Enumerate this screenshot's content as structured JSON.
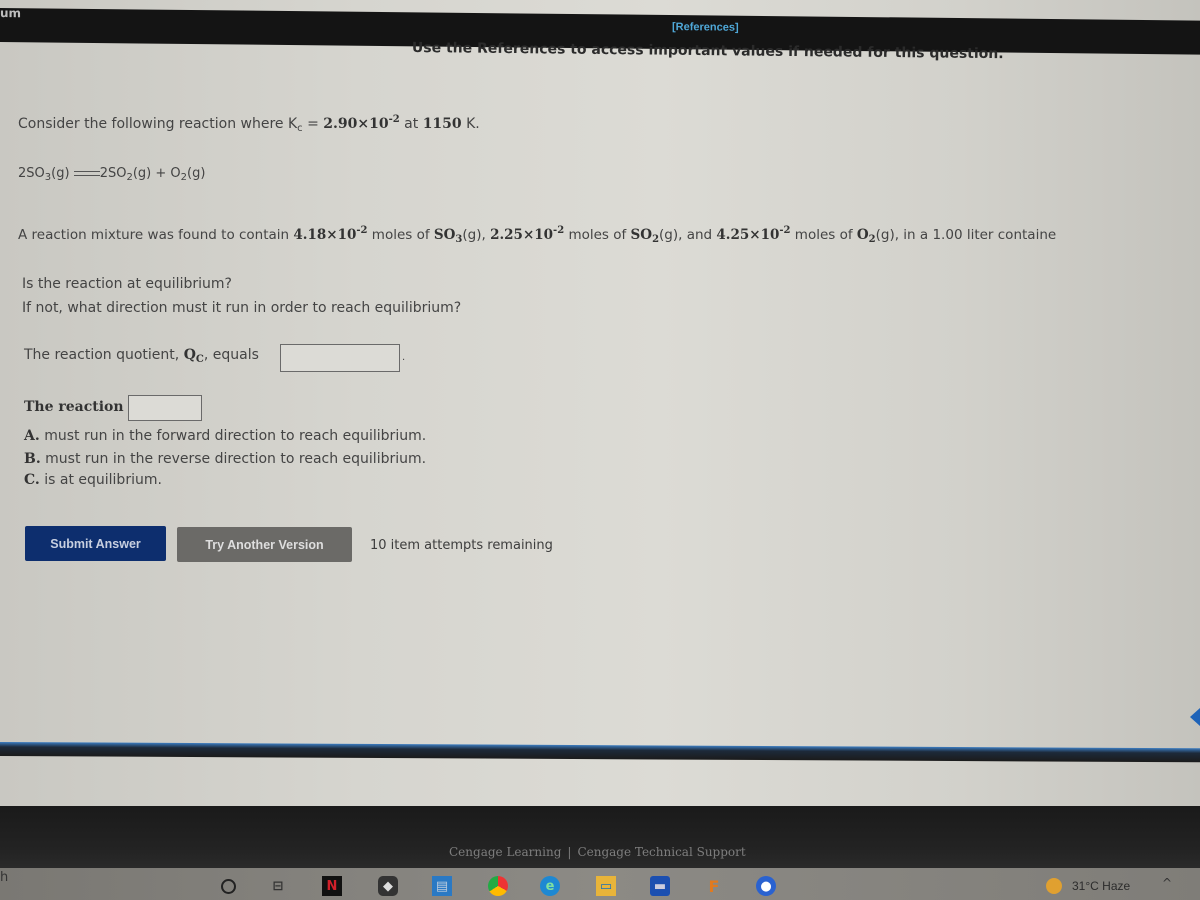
{
  "header": {
    "left_label": "um",
    "references_link": "[References]",
    "note": "Use the References to access important values if needed for this question."
  },
  "question": {
    "intro_prefix": "Consider the following reaction where K",
    "intro_kc_sub": "c",
    "intro_eq": " = ",
    "kc_value_mantissa": "2.90×10",
    "kc_value_exp": "-2",
    "intro_at": " at ",
    "temperature": "1150",
    "temperature_unit": " K.",
    "reaction": {
      "reactant_coef": "2SO",
      "reactant_sub": "3",
      "reactant_state": "(g)",
      "product1_coef": "2SO",
      "product1_sub": "2",
      "product1_state": "(g)",
      "plus": " + ",
      "product2": "O",
      "product2_sub": "2",
      "product2_state": "(g)"
    },
    "mixture": {
      "prefix": "A reaction mixture was found to contain ",
      "so3_amount": "4.18×10",
      "so3_exp": "-2",
      "moles_of": " moles of ",
      "so3_label": "SO",
      "so3_sub": "3",
      "so3_state": "(g), ",
      "so2_amount": "2.25×10",
      "so2_exp": "-2",
      "so2_label": "SO",
      "so2_sub": "2",
      "so2_state": "(g), and ",
      "o2_amount": "4.25×10",
      "o2_exp": "-2",
      "o2_label": "O",
      "o2_sub": "2",
      "o2_state": "(g), in a 1.00 liter containe"
    },
    "q1": "Is the reaction at equilibrium?",
    "q2": "If not, what direction must it run in order to reach equilibrium?",
    "qc_prefix": "The reaction quotient, ",
    "qc_symbol": "Q",
    "qc_sub": "C",
    "qc_suffix": ", equals",
    "qc_value": "",
    "qc_period": ".",
    "reaction_label": "The reaction",
    "reaction_value": "",
    "options": [
      {
        "letter": "A.",
        "text": " must run in the forward direction to reach equilibrium."
      },
      {
        "letter": "B.",
        "text": " must run in the reverse direction to reach equilibrium."
      },
      {
        "letter": "C.",
        "text": " is at equilibrium."
      }
    ]
  },
  "actions": {
    "submit_label": "Submit Answer",
    "try_another_label": "Try Another Version",
    "attempts_text": "10 item attempts remaining"
  },
  "footer": {
    "link1": "Cengage Learning",
    "separator": "|",
    "link2": "Cengage Technical Support"
  },
  "taskbar": {
    "left_label": "h",
    "weather": "31°C  Haze",
    "chevron": "^"
  }
}
